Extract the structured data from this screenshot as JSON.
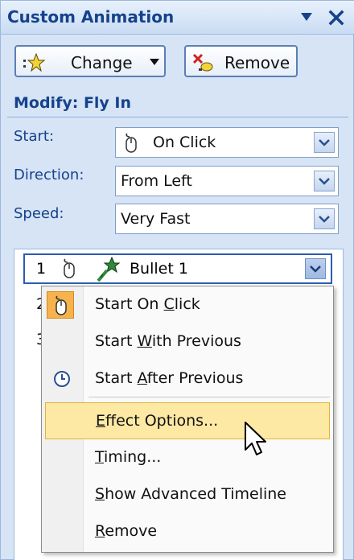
{
  "panel": {
    "title": "Custom Animation"
  },
  "toolbar": {
    "change_label": "Change",
    "remove_label": "Remove"
  },
  "modify": {
    "heading": "Modify: Fly In",
    "start_label": "Start:",
    "start_value": "On Click",
    "direction_label": "Direction:",
    "direction_value": "From Left",
    "speed_label": "Speed:",
    "speed_value": "Very Fast"
  },
  "list": {
    "items": [
      {
        "num": "1",
        "name": "Bullet 1"
      },
      {
        "num": "2"
      },
      {
        "num": "3"
      }
    ]
  },
  "menu": {
    "items": [
      {
        "pre": "Start On ",
        "key": "C",
        "post": "lick"
      },
      {
        "pre": "Start ",
        "key": "W",
        "post": "ith Previous"
      },
      {
        "pre": "Start ",
        "key": "A",
        "post": "fter Previous"
      },
      {
        "pre": "",
        "key": "E",
        "post": "ffect Options..."
      },
      {
        "pre": "",
        "key": "T",
        "post": "iming..."
      },
      {
        "pre": "",
        "key": "S",
        "post": "how Advanced Timeline"
      },
      {
        "pre": "",
        "key": "R",
        "post": "emove"
      }
    ]
  },
  "colors": {
    "accent": "#15428b",
    "highlight": "#fde9a4",
    "panel_bg": "#d6e4f6"
  }
}
